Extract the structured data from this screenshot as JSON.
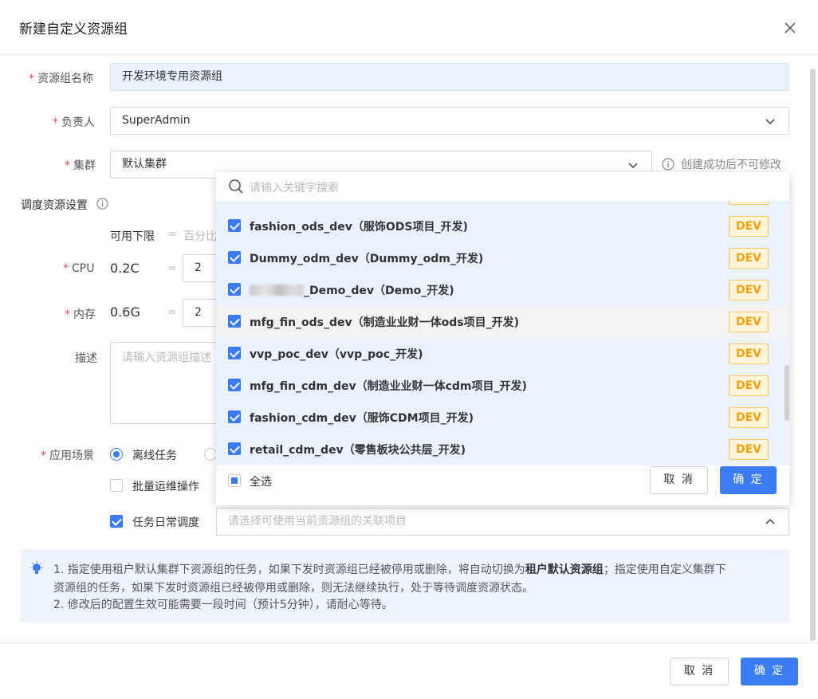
{
  "dialog": {
    "title": "新建自定义资源组",
    "close_icon": "close-icon"
  },
  "form": {
    "name": {
      "label": "资源组名称",
      "value": "开发环境专用资源组"
    },
    "owner": {
      "label": "负责人",
      "value": "SuperAdmin"
    },
    "cluster": {
      "label": "集群",
      "value": "默认集群",
      "hint": "创建成功后不可修改"
    },
    "schedule_section": {
      "title": "调度资源设置"
    },
    "lower_limit": {
      "label": "可用下限",
      "eq": "=",
      "text": "百分比"
    },
    "cpu": {
      "label": "CPU",
      "value": "0.2C",
      "eq": "=",
      "input": "2"
    },
    "memory": {
      "label": "内存",
      "value": "0.6G",
      "eq": "=",
      "input": "2"
    },
    "description": {
      "label": "描述",
      "placeholder": "请输入资源组描述"
    },
    "scenario": {
      "label": "应用场景",
      "offline_label": "离线任务",
      "batch_label": "批量运维操作",
      "daily_label": "任务日常调度",
      "project_placeholder": "请选择可使用当前资源组的关联项目"
    }
  },
  "dropdown": {
    "search_placeholder": "请输入关键字搜索",
    "tag": "DEV",
    "items": [
      {
        "name": "fashion_ods_dev（服饰ODS项目_开发)",
        "checked": true
      },
      {
        "name": "Dummy_odm_dev（Dummy_odm_开发)",
        "checked": true
      },
      {
        "name": "_Demo_dev（Demo_开发)",
        "checked": true
      },
      {
        "name": "mfg_fin_ods_dev（制造业业财一体ods项目_开发)",
        "checked": true
      },
      {
        "name": "vvp_poc_dev（vvp_poc_开发)",
        "checked": true
      },
      {
        "name": "mfg_fin_cdm_dev（制造业业财一体cdm项目_开发)",
        "checked": true
      },
      {
        "name": "fashion_cdm_dev（服饰CDM项目_开发)",
        "checked": true
      },
      {
        "name": "retail_cdm_dev（零售板块公共层_开发)",
        "checked": true
      }
    ],
    "select_all": "全选",
    "cancel": "取 消",
    "confirm": "确 定"
  },
  "tip": {
    "line1_a": "1. 指定使用租户默认集群下资源组的任务，如果下发时资源组已经被停用或删除，将自动切换为",
    "line1_b": "租户默认资源组",
    "line1_c": "；指定使用自定义集群下",
    "line2": "资源组的任务，如果下发时资源组已经被停用或删除，则无法继续执行，处于等待调度资源状态。",
    "line3": "2. 修改后的配置生效可能需要一段时间（预计5分钟），请耐心等待。"
  },
  "footer": {
    "cancel": "取 消",
    "confirm": "确 定"
  },
  "colors": {
    "primary": "#3b7cf5",
    "required": "#e34d59",
    "tag_text": "#f0a300",
    "tag_bg": "#fff4d9"
  }
}
